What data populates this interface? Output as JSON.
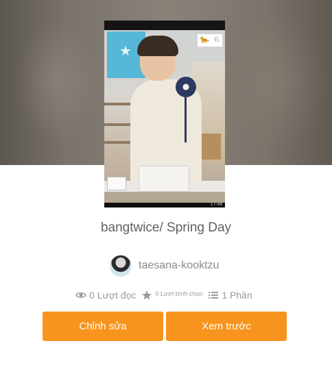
{
  "story": {
    "title": "bangtwice/ Spring Day",
    "cover": {
      "overlay_text": "17:48",
      "icons": [
        "puma-logo-icon",
        "brand-mark-icon"
      ]
    }
  },
  "author": {
    "name": "taesana-kooktzu"
  },
  "stats": {
    "reads": "0 Lượt đọc",
    "votes": "0 Lượt bình chọn",
    "parts": "1 Phần",
    "icons": {
      "reads": "eye-icon",
      "votes": "star-icon",
      "parts": "list-icon"
    }
  },
  "actions": {
    "edit_label": "Chỉnh sửa",
    "preview_label": "Xem trước"
  },
  "colors": {
    "accent": "#f7941d",
    "title_text": "#5f5f5f",
    "meta_text": "#9a9a9a",
    "banner": "#7a736b"
  }
}
